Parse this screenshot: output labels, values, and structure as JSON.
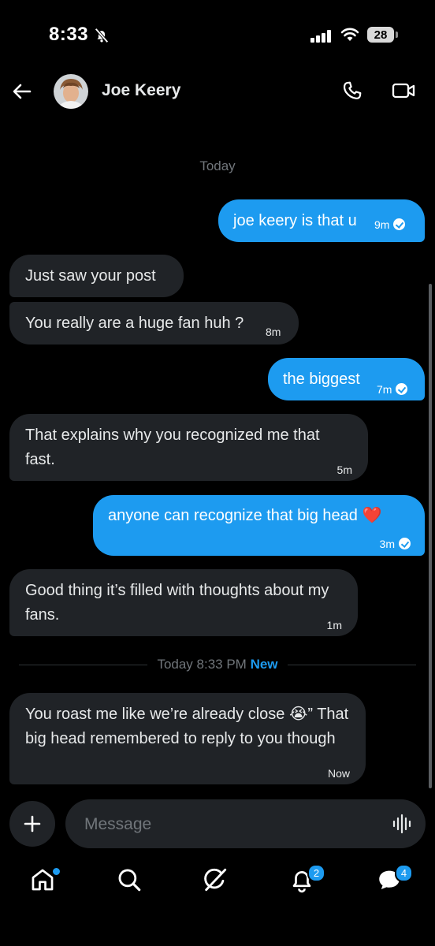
{
  "status_bar": {
    "time": "8:33",
    "battery": "28"
  },
  "header": {
    "contact_name": "Joe Keery"
  },
  "conversation": {
    "day_label": "Today",
    "messages": [
      {
        "direction": "outgoing",
        "text": "joe keery is that u",
        "time": "9m",
        "read": true
      },
      {
        "direction": "incoming",
        "text": "Just saw your post",
        "time": ""
      },
      {
        "direction": "incoming",
        "text": "You really are a huge fan huh ?",
        "time": "8m"
      },
      {
        "direction": "outgoing",
        "text": "the biggest",
        "time": "7m",
        "read": true
      },
      {
        "direction": "incoming",
        "text": "That explains why you recognized me that fast.",
        "time": "5m"
      },
      {
        "direction": "outgoing",
        "text": "anyone can recognize that big head ❤️",
        "time": "3m",
        "read": true
      },
      {
        "direction": "incoming",
        "text": "Good thing it’s filled with thoughts about my fans.",
        "time": "1m"
      },
      {
        "direction": "incoming",
        "text": "You roast me like we’re already close 😭” That big head remembered to reply to you though",
        "time": "Now"
      }
    ],
    "divider": {
      "label": "Today 8:33 PM",
      "new_label": "New"
    }
  },
  "composer": {
    "placeholder": "Message"
  },
  "tab_bar": {
    "items": [
      "home",
      "search",
      "grok",
      "notifications",
      "messages"
    ],
    "notifications_badge": "2",
    "messages_badge": "4"
  },
  "colors": {
    "accent": "#1d9bf0",
    "incoming_bubble": "#202327",
    "background": "#000000"
  }
}
